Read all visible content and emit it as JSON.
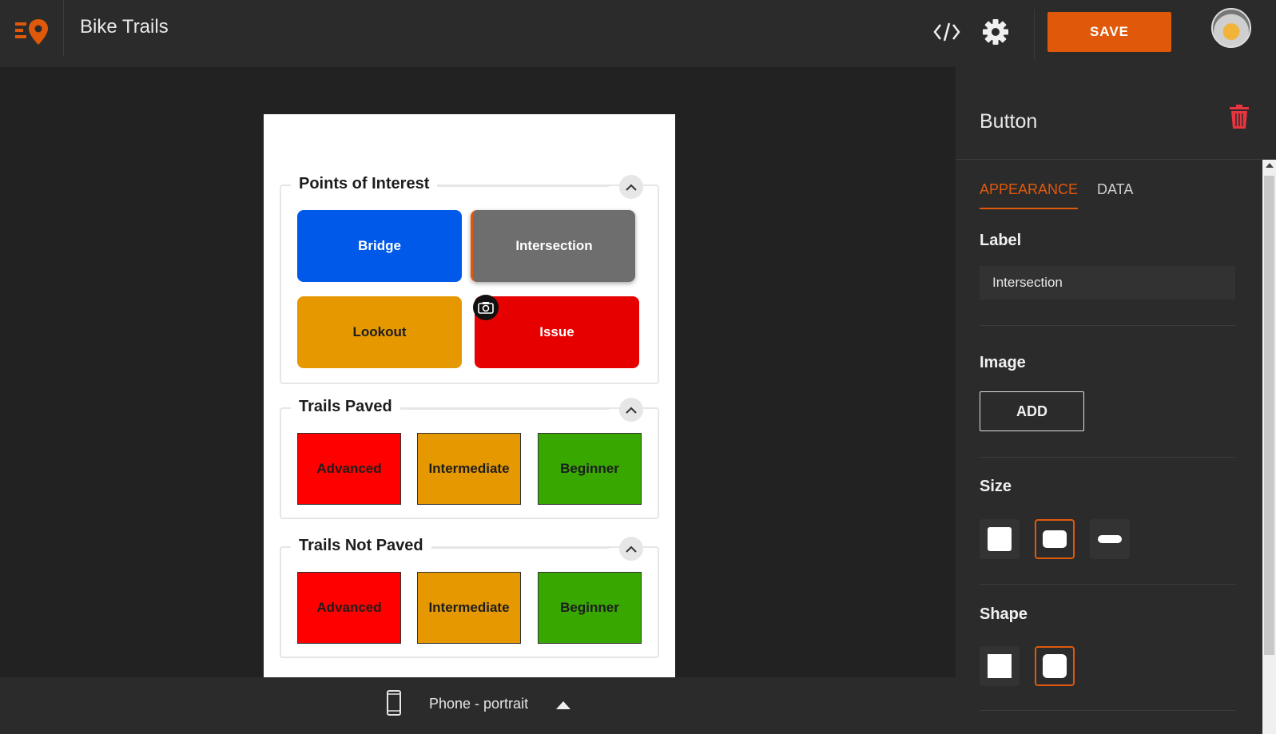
{
  "header": {
    "app_title": "Bike Trails",
    "save_label": "SAVE",
    "icons": [
      "logo-icon",
      "code-icon",
      "gear-icon",
      "avatar"
    ],
    "accent_color": "#e0590b"
  },
  "canvas": {
    "groups": [
      {
        "title": "Points of Interest",
        "buttons": [
          {
            "label": "Bridge",
            "color": "#0059e8"
          },
          {
            "label": "Intersection",
            "color": "#6e6e6e",
            "selected": true
          },
          {
            "label": "Lookout",
            "color": "#e59800"
          },
          {
            "label": "Issue",
            "color": "#e60000",
            "icon": "camera-icon"
          }
        ]
      },
      {
        "title": "Trails Paved",
        "buttons": [
          {
            "label": "Advanced",
            "color": "#ff0000"
          },
          {
            "label": "Intermediate",
            "color": "#e59800"
          },
          {
            "label": "Beginner",
            "color": "#38a800"
          }
        ]
      },
      {
        "title": "Trails Not Paved",
        "buttons": [
          {
            "label": "Advanced",
            "color": "#ff0000"
          },
          {
            "label": "Intermediate",
            "color": "#e59800"
          },
          {
            "label": "Beginner",
            "color": "#38a800"
          }
        ]
      }
    ]
  },
  "bottom_bar": {
    "device_label": "Phone - portrait"
  },
  "panel": {
    "title": "Button",
    "tabs": [
      {
        "label": "APPEARANCE",
        "active": true
      },
      {
        "label": "DATA",
        "active": false
      }
    ],
    "label_section": {
      "heading": "Label",
      "value": "Intersection"
    },
    "image_section": {
      "heading": "Image",
      "add_label": "ADD"
    },
    "size_section": {
      "heading": "Size",
      "options": [
        "small",
        "medium",
        "wide"
      ],
      "selected": "medium"
    },
    "shape_section": {
      "heading": "Shape",
      "options": [
        "square",
        "rounded"
      ],
      "selected": "rounded"
    }
  }
}
